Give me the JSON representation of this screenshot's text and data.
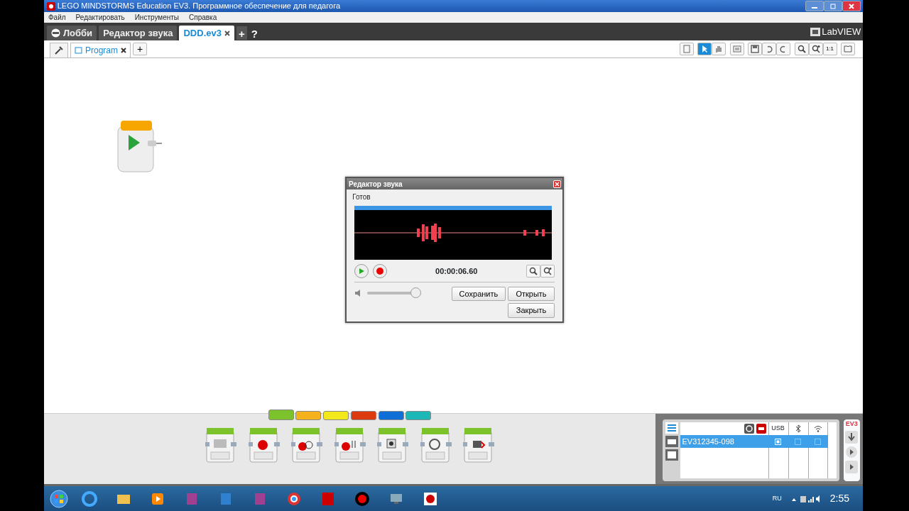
{
  "window": {
    "title": "LEGO MINDSTORMS Education EV3. Программное обеспечение для педагога"
  },
  "menu": [
    "Файл",
    "Редактировать",
    "Инструменты",
    "Справка"
  ],
  "project_tabs": [
    {
      "label": "Лобби",
      "kind": "home",
      "selected": false
    },
    {
      "label": "Редактор звука",
      "kind": "tool",
      "selected": false
    },
    {
      "label": "DDD.ev3",
      "kind": "project",
      "selected": true
    }
  ],
  "add_tab": "+",
  "help": "?",
  "brand": "LabVIEW",
  "program_tabs": [
    {
      "label": "Program",
      "selected": true
    }
  ],
  "add_program": "+",
  "tools": [
    {
      "kind": "pointer",
      "selected": true
    },
    {
      "kind": "hand",
      "selected": false
    }
  ],
  "zoom_reset": "1:1",
  "dialog": {
    "title": "Редактор звука",
    "status": "Готов",
    "time": "00:00:06.60",
    "volume": {
      "level": 0.92
    },
    "buttons": [
      {
        "label": "Сохранить"
      },
      {
        "label": "Открыть"
      },
      {
        "label": "Закрыть"
      }
    ]
  },
  "palette": {
    "tabs": [
      {
        "color": "#7cc22a",
        "selected": true
      },
      {
        "color": "#f6b21c",
        "selected": false
      },
      {
        "color": "#f2e81a",
        "selected": false
      },
      {
        "color": "#dd3a10",
        "selected": false
      },
      {
        "color": "#0f6fd6",
        "selected": false
      },
      {
        "color": "#1cb8b8",
        "selected": false
      }
    ],
    "blocks": [
      {
        "kind": "medium-motor"
      },
      {
        "kind": "large-motor"
      },
      {
        "kind": "move-steering"
      },
      {
        "kind": "move-tank"
      },
      {
        "kind": "display"
      },
      {
        "kind": "sound"
      },
      {
        "kind": "brick-light"
      }
    ]
  },
  "hardware": {
    "brick": "EV3",
    "usb": "USB",
    "devices": [
      {
        "name": "EV312345-098",
        "selected": true,
        "usb": true,
        "bluetooth": false,
        "wifi": false
      }
    ]
  },
  "taskbar": {
    "language": "RU",
    "clock": "2:55"
  }
}
